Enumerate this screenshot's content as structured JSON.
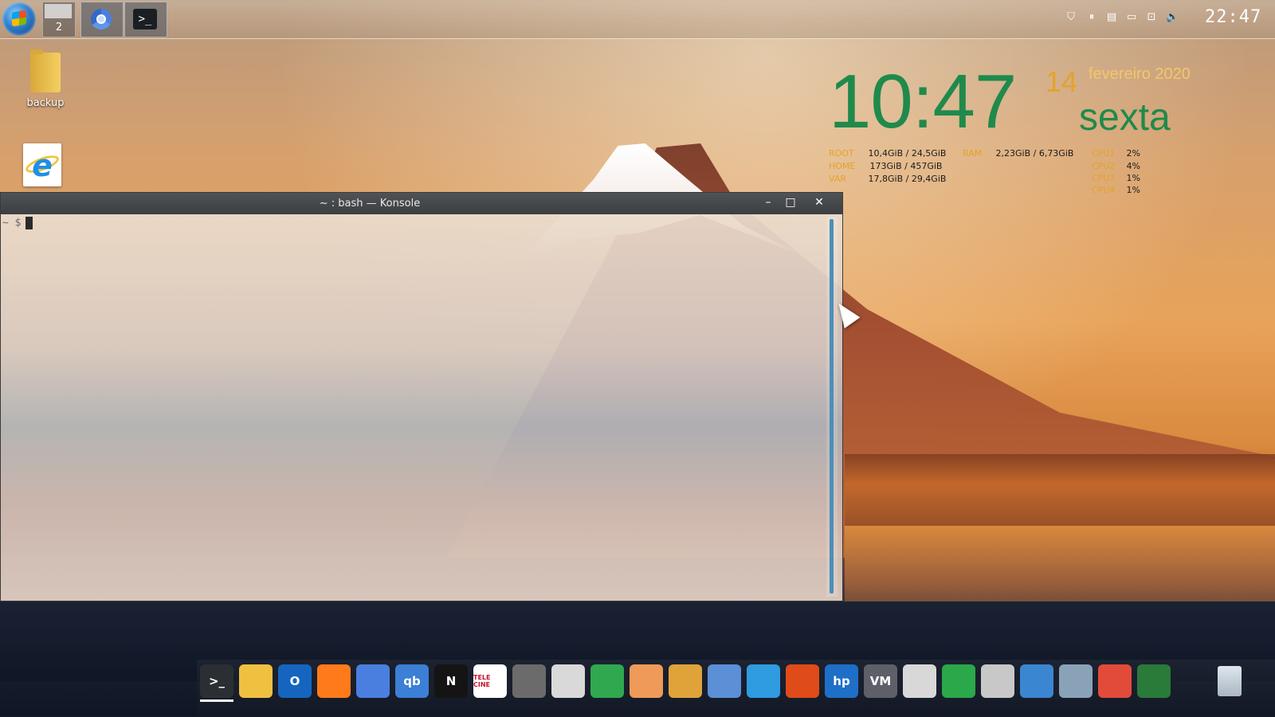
{
  "top_panel": {
    "pager_number": "2",
    "clock": "22:47",
    "tray_icons": [
      "shield-icon",
      "pause-icon",
      "clipboard-icon",
      "display-icon",
      "network-icon",
      "volume-icon"
    ]
  },
  "desktop_icons": [
    {
      "label": "backup",
      "icon": "folder-icon"
    },
    {
      "label": "",
      "icon": "internet-explorer-icon"
    }
  ],
  "conky": {
    "time": "10:47",
    "day": "14",
    "month_year": "fevereiro 2020",
    "weekday": "sexta",
    "disks": [
      {
        "label": "ROOT",
        "value": "10,4GiB / 24,5GiB"
      },
      {
        "label": "HOME",
        "value": "173GiB / 457GiB"
      },
      {
        "label": "VAR",
        "value": "17,8GiB / 29,4GiB"
      }
    ],
    "ram": {
      "label": "RAM",
      "value": "2,23GiB / 6,73GiB"
    },
    "cpus": [
      {
        "label": "CPU1",
        "value": "2%"
      },
      {
        "label": "CPU2",
        "value": "4%"
      },
      {
        "label": "CPU3",
        "value": "1%"
      },
      {
        "label": "CPU4",
        "value": "1%"
      }
    ]
  },
  "konsole": {
    "title": "~ : bash — Konsole",
    "prompt": "~ $"
  },
  "dock": {
    "items": [
      {
        "name": "konsole-icon",
        "text": ">_",
        "color": "#2b2f33"
      },
      {
        "name": "file-manager-icon",
        "text": "",
        "color": "#f0c040"
      },
      {
        "name": "outlook-icon",
        "text": "O",
        "color": "#1565c0"
      },
      {
        "name": "firefox-icon",
        "text": "",
        "color": "#ff7a1a"
      },
      {
        "name": "chromium-icon",
        "text": "",
        "color": "#4a7fe0"
      },
      {
        "name": "qbittorrent-icon",
        "text": "qb",
        "color": "#3b7fd6"
      },
      {
        "name": "netflix-icon",
        "text": "N",
        "color": "#141414"
      },
      {
        "name": "telecine-icon",
        "text": "TELE CINE",
        "color": "#ffffff"
      },
      {
        "name": "gimp-icon",
        "text": "",
        "color": "#6b6b6b"
      },
      {
        "name": "inkscape-icon",
        "text": "",
        "color": "#d9d9d9"
      },
      {
        "name": "color-picker-icon",
        "text": "",
        "color": "#2fa84f"
      },
      {
        "name": "melon-icon",
        "text": "",
        "color": "#f09a5a"
      },
      {
        "name": "radio-icon",
        "text": "",
        "color": "#e0a33a"
      },
      {
        "name": "media-icon",
        "text": "",
        "color": "#5b8fd6"
      },
      {
        "name": "browser-globe-icon",
        "text": "",
        "color": "#2f9be0"
      },
      {
        "name": "office-icon",
        "text": "",
        "color": "#e04b1a"
      },
      {
        "name": "hp-icon",
        "text": "hp",
        "color": "#1e6fc7"
      },
      {
        "name": "vm-icon",
        "text": "VM",
        "color": "#5f5f6a"
      },
      {
        "name": "calculator-icon",
        "text": "",
        "color": "#d8d8d8"
      },
      {
        "name": "monitor-icon",
        "text": "",
        "color": "#2aa84a"
      },
      {
        "name": "scanner-icon",
        "text": "",
        "color": "#c8c8c8"
      },
      {
        "name": "id-card-icon",
        "text": "",
        "color": "#3a86d1"
      },
      {
        "name": "search-icon",
        "text": "",
        "color": "#8aa2b8"
      },
      {
        "name": "screen-recorder-icon",
        "text": "",
        "color": "#e24b3a"
      },
      {
        "name": "globe-icon",
        "text": "",
        "color": "#2a7a3a"
      }
    ]
  }
}
